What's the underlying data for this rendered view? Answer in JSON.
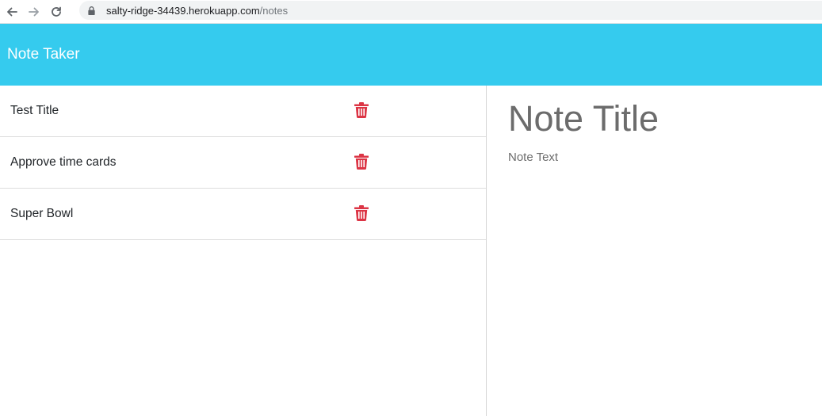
{
  "browser": {
    "url_host": "salty-ridge-34439.herokuapp.com",
    "url_path": "/notes"
  },
  "navbar": {
    "brand": "Note Taker",
    "color": "#35cbee"
  },
  "notes": [
    {
      "title": "Test Title"
    },
    {
      "title": "Approve time cards"
    },
    {
      "title": "Super Bowl"
    }
  ],
  "editor": {
    "title_placeholder": "Note Title",
    "text_placeholder": "Note Text"
  },
  "icons": {
    "delete": "trash-icon",
    "delete_color": "#dc3545"
  }
}
